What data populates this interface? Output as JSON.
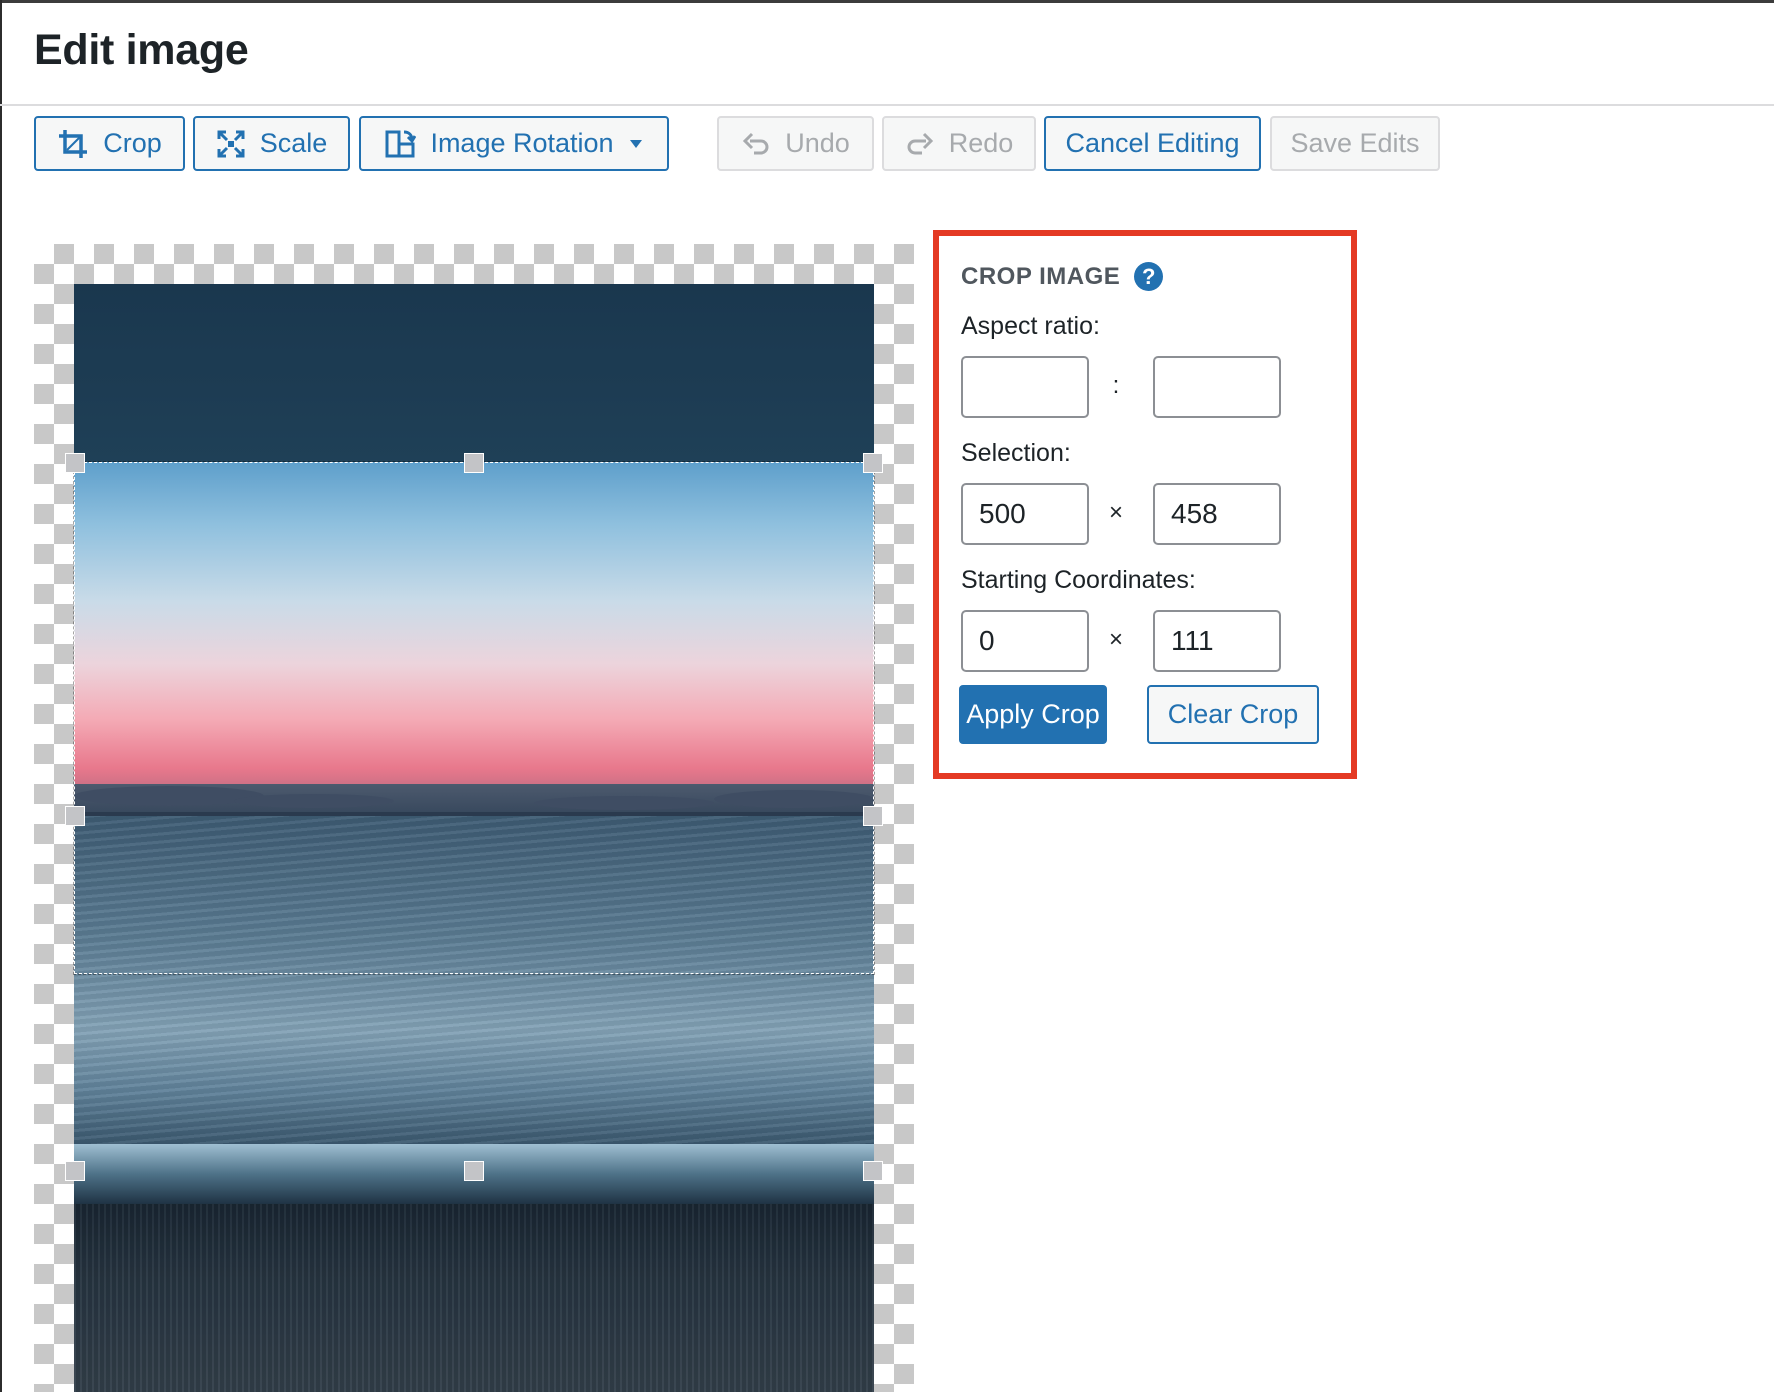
{
  "page": {
    "title": "Edit image"
  },
  "toolbar": {
    "crop": {
      "label": "Crop",
      "icon": "crop-icon"
    },
    "scale": {
      "label": "Scale",
      "icon": "scale-icon"
    },
    "rotation": {
      "label": "Image Rotation",
      "icon": "rotate-icon",
      "dropdown_icon": "caret-down-icon"
    },
    "undo": {
      "label": "Undo",
      "icon": "undo-icon",
      "disabled": true
    },
    "redo": {
      "label": "Redo",
      "icon": "redo-icon",
      "disabled": true
    },
    "cancel": {
      "label": "Cancel Editing"
    },
    "save": {
      "label": "Save Edits",
      "disabled": true
    }
  },
  "crop_panel": {
    "title": "CROP IMAGE",
    "help_icon": "?",
    "aspect_ratio": {
      "label": "Aspect ratio:",
      "width": "",
      "height": "",
      "separator": ":"
    },
    "selection": {
      "label": "Selection:",
      "width": "500",
      "height": "458",
      "separator": "×"
    },
    "starting_coordinates": {
      "label": "Starting Coordinates:",
      "x": "0",
      "y": "111",
      "separator": "×"
    },
    "apply_label": "Apply Crop",
    "clear_label": "Clear Crop"
  },
  "colors": {
    "accent": "#2271b1",
    "highlight_border": "#e43a24",
    "disabled_text": "#a7aaad"
  }
}
